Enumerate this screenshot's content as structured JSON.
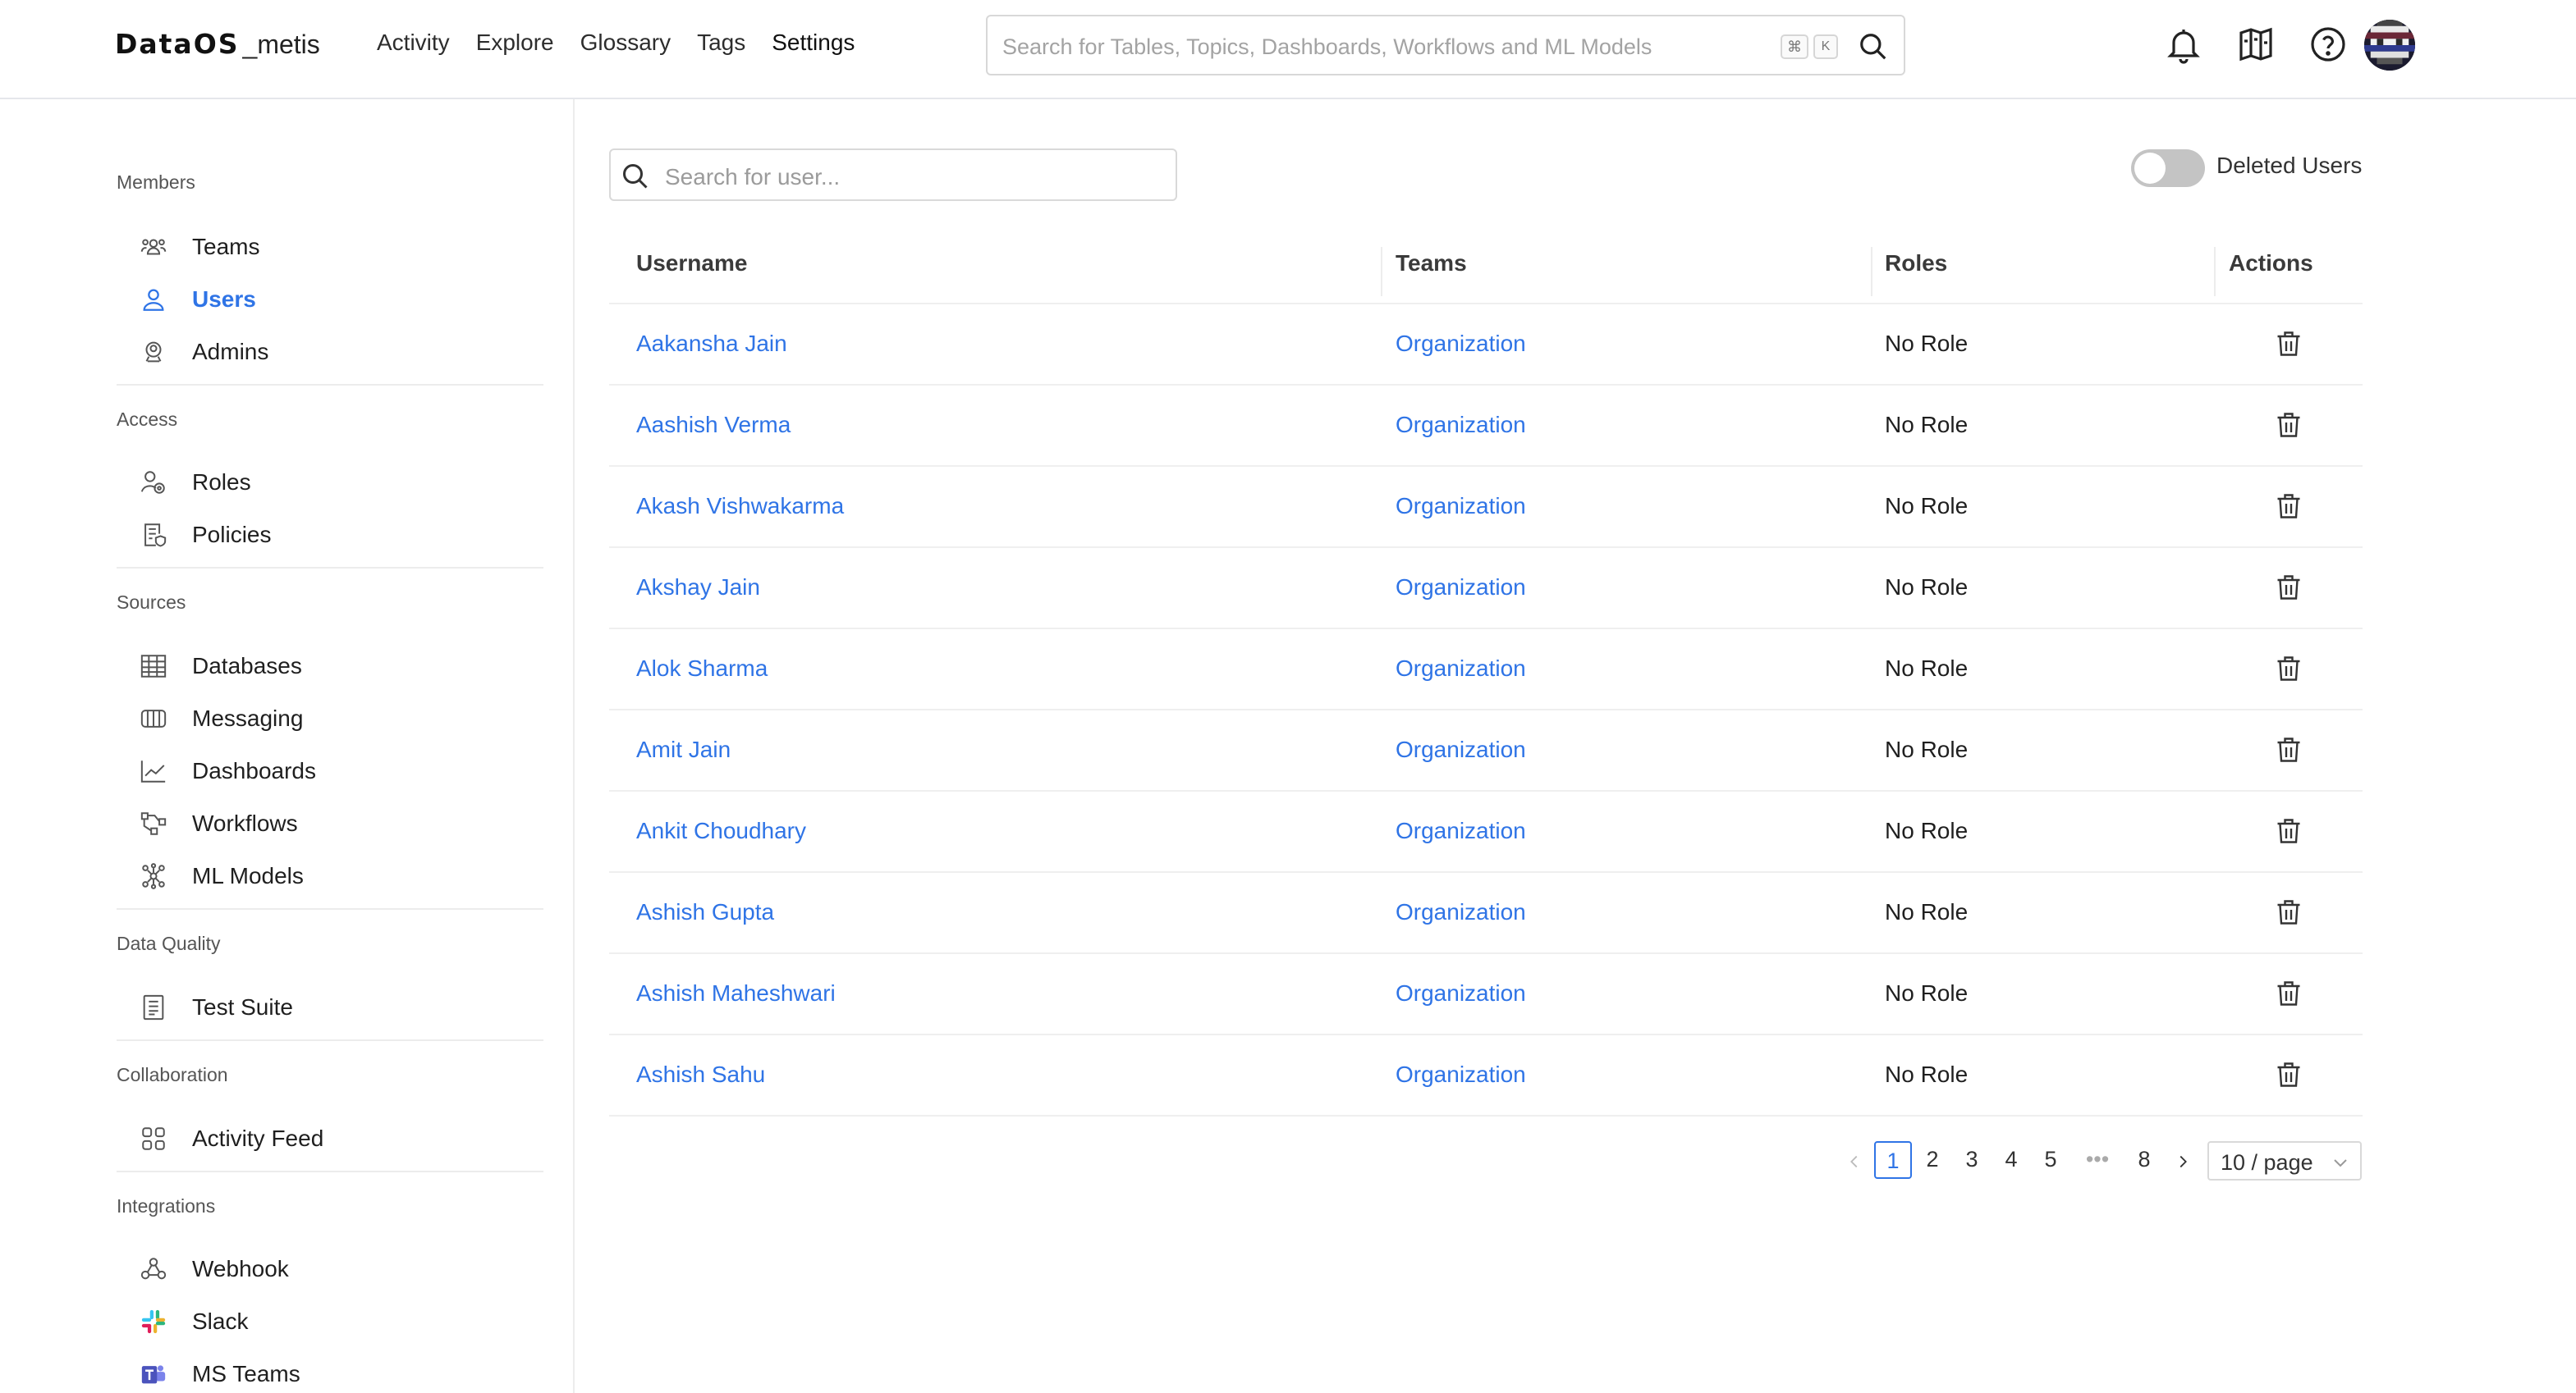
{
  "header": {
    "logo_brand": "DataOS",
    "logo_suffix": "_metis",
    "nav": [
      "Activity",
      "Explore",
      "Glossary",
      "Tags",
      "Settings"
    ],
    "active_nav": "Settings",
    "search_placeholder": "Search for Tables, Topics, Dashboards, Workflows and ML Models",
    "shortcut_keys": [
      "⌘",
      "K"
    ],
    "icons": [
      "bell-icon",
      "map-book-icon",
      "help-circle-icon",
      "avatar"
    ]
  },
  "sidebar": {
    "groups": [
      {
        "title": "Members",
        "items": [
          {
            "label": "Teams",
            "icon": "teams-icon"
          },
          {
            "label": "Users",
            "icon": "user-icon",
            "active": true
          },
          {
            "label": "Admins",
            "icon": "admin-icon"
          }
        ]
      },
      {
        "title": "Access",
        "items": [
          {
            "label": "Roles",
            "icon": "roles-icon"
          },
          {
            "label": "Policies",
            "icon": "policies-icon"
          }
        ]
      },
      {
        "title": "Sources",
        "items": [
          {
            "label": "Databases",
            "icon": "table-icon"
          },
          {
            "label": "Messaging",
            "icon": "messaging-icon"
          },
          {
            "label": "Dashboards",
            "icon": "chart-line-icon"
          },
          {
            "label": "Workflows",
            "icon": "workflow-icon"
          },
          {
            "label": "ML Models",
            "icon": "ml-model-icon"
          }
        ]
      },
      {
        "title": "Data Quality",
        "items": [
          {
            "label": "Test Suite",
            "icon": "test-suite-icon"
          }
        ]
      },
      {
        "title": "Collaboration",
        "items": [
          {
            "label": "Activity Feed",
            "icon": "activity-feed-icon"
          }
        ]
      },
      {
        "title": "Integrations",
        "items": [
          {
            "label": "Webhook",
            "icon": "webhook-icon"
          },
          {
            "label": "Slack",
            "icon": "slack-icon"
          },
          {
            "label": "MS Teams",
            "icon": "ms-teams-icon"
          }
        ]
      }
    ]
  },
  "main": {
    "user_search_placeholder": "Search for user...",
    "deleted_users_label": "Deleted Users",
    "deleted_users_on": false,
    "columns": [
      "Username",
      "Teams",
      "Roles",
      "Actions"
    ],
    "rows": [
      {
        "username": "Aakansha Jain",
        "team": "Organization",
        "role": "No Role"
      },
      {
        "username": "Aashish Verma",
        "team": "Organization",
        "role": "No Role"
      },
      {
        "username": "Akash Vishwakarma",
        "team": "Organization",
        "role": "No Role"
      },
      {
        "username": "Akshay Jain",
        "team": "Organization",
        "role": "No Role"
      },
      {
        "username": "Alok Sharma",
        "team": "Organization",
        "role": "No Role"
      },
      {
        "username": "Amit Jain",
        "team": "Organization",
        "role": "No Role"
      },
      {
        "username": "Ankit Choudhary",
        "team": "Organization",
        "role": "No Role"
      },
      {
        "username": "Ashish Gupta",
        "team": "Organization",
        "role": "No Role"
      },
      {
        "username": "Ashish Maheshwari",
        "team": "Organization",
        "role": "No Role"
      },
      {
        "username": "Ashish Sahu",
        "team": "Organization",
        "role": "No Role"
      }
    ],
    "pagination": {
      "pages": [
        "1",
        "2",
        "3",
        "4",
        "5",
        "•••",
        "8"
      ],
      "current": "1",
      "page_size": "10 / page"
    }
  },
  "colors": {
    "accent": "#2f74e6",
    "text": "#1f1f1f",
    "muted": "#555555",
    "border": "#e5e7eb"
  }
}
